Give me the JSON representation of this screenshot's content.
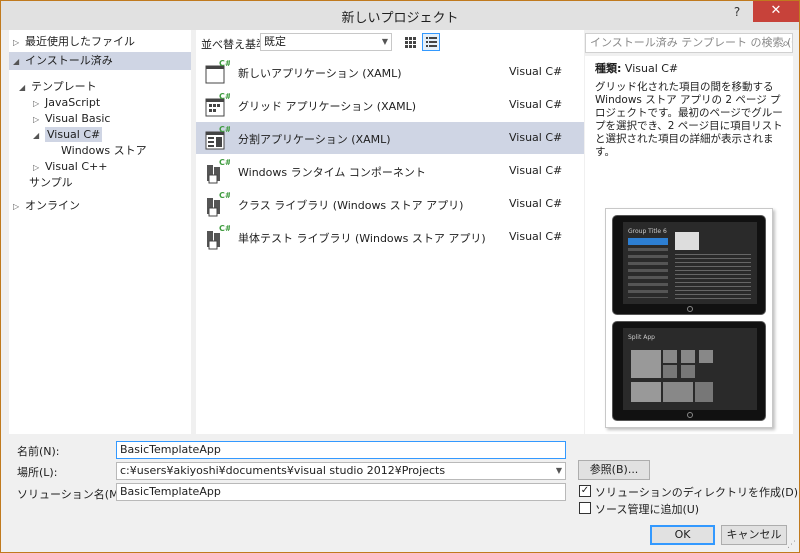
{
  "window": {
    "title": "新しいプロジェクト",
    "help": "?",
    "close": "✕"
  },
  "sidebar": {
    "recent": "最近使用したファイル",
    "installed": "インストール済み",
    "templates": "テンプレート",
    "javascript": "JavaScript",
    "vb": "Visual Basic",
    "csharp": "Visual C#",
    "store": "Windows ストア",
    "cpp": "Visual C++",
    "samples": "サンプル",
    "online": "オンライン"
  },
  "toolbar": {
    "sort_label": "並べ替え基準:",
    "sort_value": "既定"
  },
  "templates": [
    {
      "name": "新しいアプリケーション (XAML)",
      "lang": "Visual C#"
    },
    {
      "name": "グリッド アプリケーション (XAML)",
      "lang": "Visual C#"
    },
    {
      "name": "分割アプリケーション (XAML)",
      "lang": "Visual C#"
    },
    {
      "name": "Windows ランタイム コンポーネント",
      "lang": "Visual C#"
    },
    {
      "name": "クラス ライブラリ (Windows ストア アプリ)",
      "lang": "Visual C#"
    },
    {
      "name": "単体テスト ライブラリ (Windows ストア アプリ)",
      "lang": "Visual C#"
    }
  ],
  "details": {
    "search_placeholder": "インストール済み テンプレート の検索 (Ctrl+",
    "kind_label": "種類:",
    "kind_value": "Visual C#",
    "description": "グリッド化された項目の間を移動する Windows ストア アプリの 2 ページ プロジェクトです。最初のページでグループを選択でき、2 ページ目に項目リストと選択された項目の詳細が表示されます。",
    "preview_top_title": "Group Title 6",
    "preview_bottom_title": "Split App"
  },
  "form": {
    "name_label": "名前(N):",
    "name_value": "BasicTemplateApp",
    "location_label": "場所(L):",
    "location_value": "c:¥users¥akiyoshi¥documents¥visual studio 2012¥Projects",
    "solution_label": "ソリューション名(M):",
    "solution_value": "BasicTemplateApp",
    "browse": "参照(B)...",
    "create_dir_label": "ソリューションのディレクトリを作成(D)",
    "create_dir_checked": true,
    "source_control_label": "ソース管理に追加(U)",
    "source_control_checked": false,
    "ok": "OK",
    "cancel": "キャンセル"
  },
  "colors": {
    "selection": "#cfd5e4",
    "accent": "#3399ff",
    "close": "#c7423a",
    "icon_green": "#3f9b3f"
  }
}
